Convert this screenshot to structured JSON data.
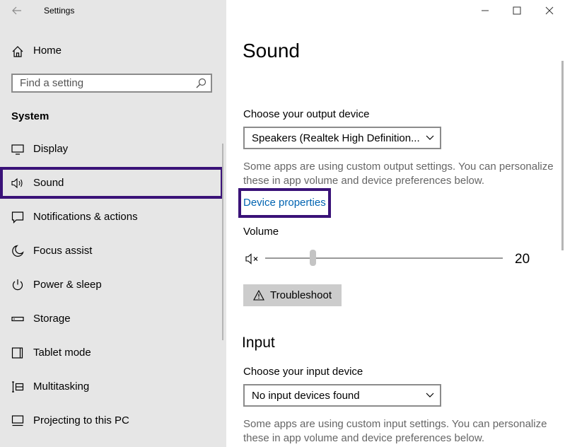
{
  "window": {
    "title": "Settings"
  },
  "sidebar": {
    "home_label": "Home",
    "search_placeholder": "Find a setting",
    "section": "System",
    "items": [
      {
        "label": "Display",
        "icon": "display-icon"
      },
      {
        "label": "Sound",
        "icon": "speaker-icon",
        "selected": true
      },
      {
        "label": "Notifications & actions",
        "icon": "notifications-icon"
      },
      {
        "label": "Focus assist",
        "icon": "moon-icon"
      },
      {
        "label": "Power & sleep",
        "icon": "power-icon"
      },
      {
        "label": "Storage",
        "icon": "storage-icon"
      },
      {
        "label": "Tablet mode",
        "icon": "tablet-icon"
      },
      {
        "label": "Multitasking",
        "icon": "multitasking-icon"
      },
      {
        "label": "Projecting to this PC",
        "icon": "projector-icon"
      }
    ]
  },
  "main": {
    "title": "Sound",
    "output": {
      "label": "Choose your output device",
      "selected": "Speakers (Realtek High Definition...",
      "help": "Some apps are using custom output settings. You can personalize these in app volume and device preferences below.",
      "device_properties": "Device properties",
      "volume_label": "Volume",
      "volume_value": "20",
      "troubleshoot": "Troubleshoot"
    },
    "input": {
      "title": "Input",
      "label": "Choose your input device",
      "selected": "No input devices found",
      "help": "Some apps are using custom input settings. You can personalize these in app volume and device preferences below."
    }
  },
  "colors": {
    "selection_outline": "#3a1278",
    "link": "#0063b1",
    "sidebar_bg": "#e6e6e6"
  }
}
